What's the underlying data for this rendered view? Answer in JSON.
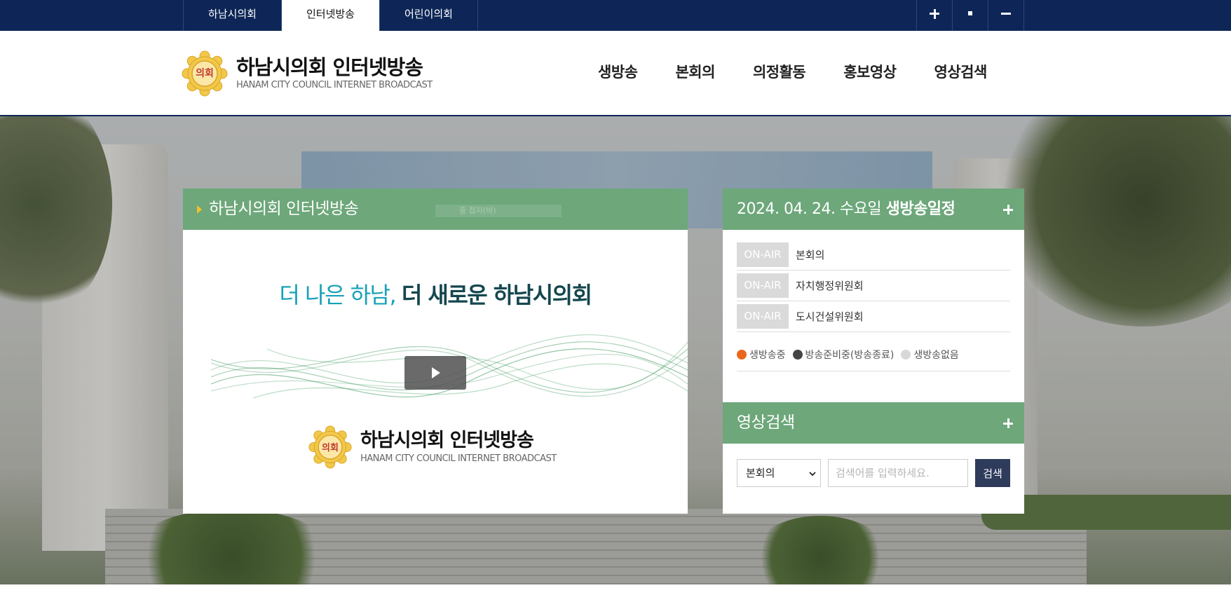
{
  "site_tabs": [
    {
      "label": "하남시의회"
    },
    {
      "label": "인터넷방송"
    },
    {
      "label": "어린이의회"
    }
  ],
  "zoom_controls": [
    "zoom-in",
    "zoom-reset",
    "zoom-out"
  ],
  "logo": {
    "title": "하남시의회 인터넷방송",
    "subtitle": "HANAM CITY COUNCIL INTERNET BROADCAST",
    "seal_text": "의회"
  },
  "nav": [
    {
      "label": "생방송"
    },
    {
      "label": "본회의"
    },
    {
      "label": "의정활동"
    },
    {
      "label": "홍보영상"
    },
    {
      "label": "영상검색"
    }
  ],
  "video": {
    "title": "하남시의회 인터넷방송",
    "ghost_text": "중 접지(바)",
    "tagline_light": "더 나은 하남, ",
    "tagline_strong": "더 새로운 하남시의회",
    "logo_title": "하남시의회 인터넷방송",
    "logo_subtitle": "HANAM CITY COUNCIL INTERNET BROADCAST",
    "seal_text": "의회"
  },
  "schedule": {
    "date": "2024. 04. 24. 수요일 ",
    "title": "생방송일정",
    "items": [
      {
        "badge": "ON-AIR",
        "name": "본회의"
      },
      {
        "badge": "ON-AIR",
        "name": "자치행정위원회"
      },
      {
        "badge": "ON-AIR",
        "name": "도시건설위원회"
      }
    ],
    "legend": [
      {
        "label": "생방송중",
        "color": "#e8671c"
      },
      {
        "label": "방송준비중(방송종료)",
        "color": "#444444"
      },
      {
        "label": "생방송없음",
        "color": "#d8d8d8"
      }
    ]
  },
  "search": {
    "title": "영상검색",
    "select_value": "본회의",
    "placeholder": "검색어를 입력하세요.",
    "button": "검색"
  },
  "colors": {
    "top_bar": "#0d2657",
    "panel_green": "#6da77a",
    "search_button": "#2f3b5b"
  }
}
